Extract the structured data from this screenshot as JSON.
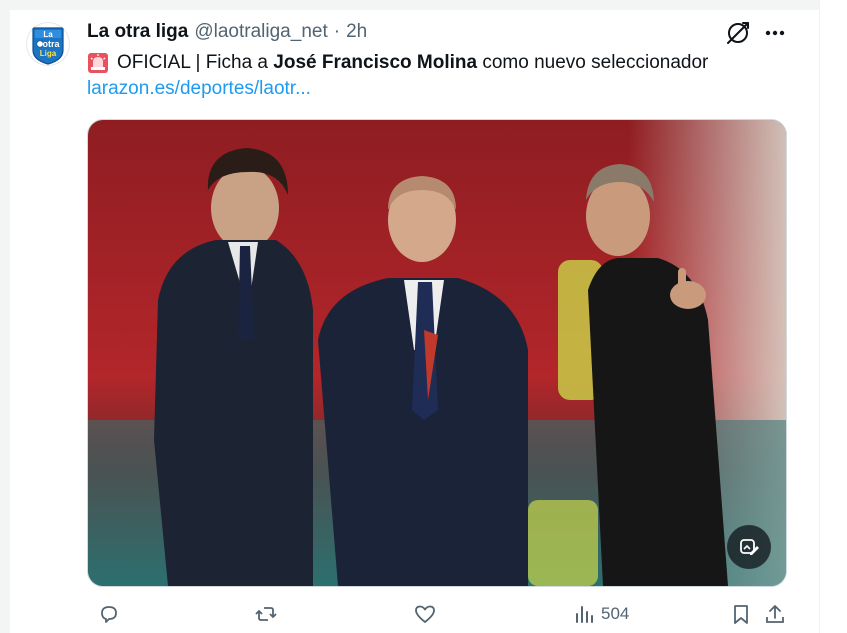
{
  "tweet": {
    "display_name": "La otra liga",
    "handle": "@laotraliga_net",
    "separator": "·",
    "time": "2h",
    "text_prefix": "OFICIAL | Ficha a ",
    "text_bold": "José Francisco Molina",
    "text_suffix": " como nuevo seleccionador",
    "link": "larazon.es/deportes/laotr...",
    "avatar_lines": [
      "La",
      "otra",
      "Liga"
    ]
  },
  "actions": {
    "views": "504"
  },
  "icons": {
    "reply": "reply-icon",
    "retweet": "retweet-icon",
    "like": "heart-icon",
    "views": "views-chart-icon",
    "bookmark": "bookmark-icon",
    "share": "share-icon",
    "grok": "grok-icon",
    "more": "more-dots-icon",
    "siren": "siren-emoji-icon",
    "media_edit": "media-edit-icon"
  },
  "colors": {
    "link": "#1d9bf0",
    "text": "#0f1419",
    "muted": "#536471",
    "stadium_red": "#b3262a"
  }
}
